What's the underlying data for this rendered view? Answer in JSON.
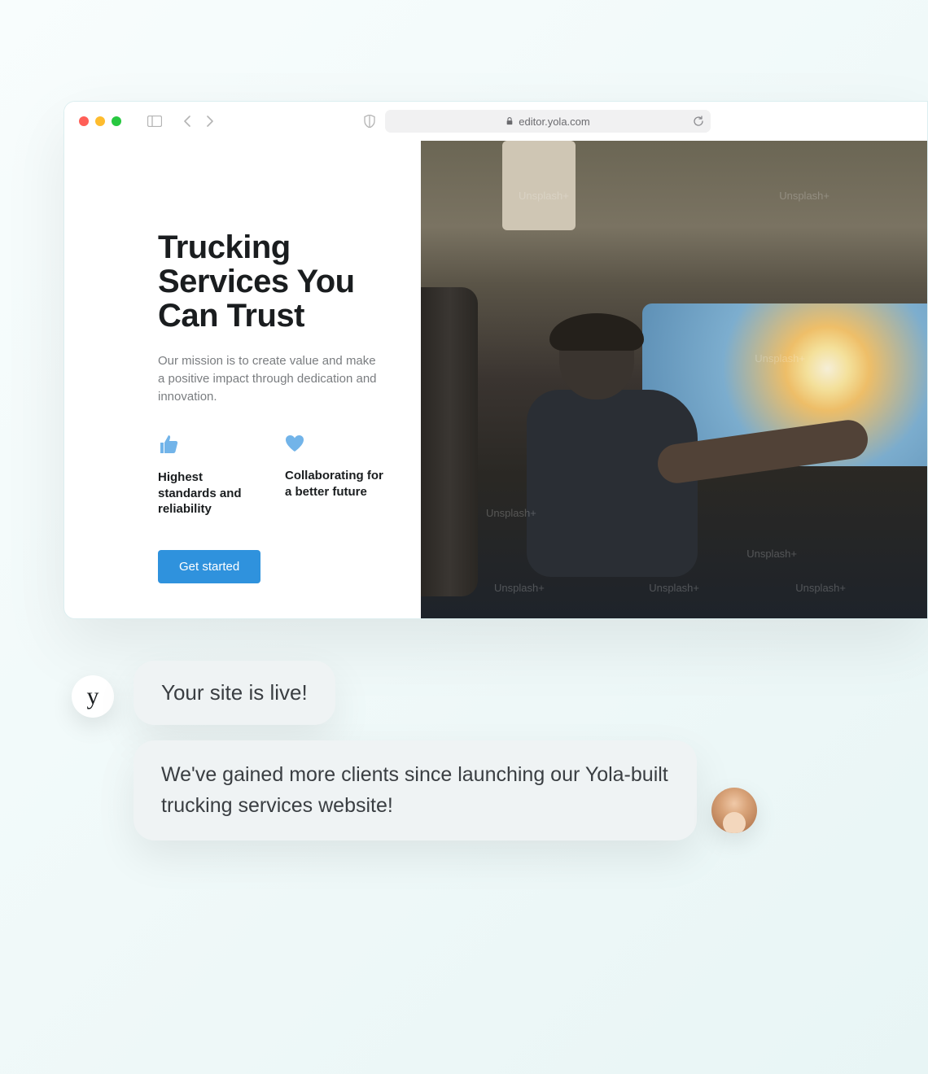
{
  "browser": {
    "url": "editor.yola.com",
    "traffic_light_colors": {
      "red": "#ff5f57",
      "yellow": "#febc2e",
      "green": "#28c840"
    }
  },
  "hero": {
    "title": "Trucking Services You Can Trust",
    "subtitle": "Our mission is to create value and make a positive impact through dedication and innovation.",
    "features": [
      {
        "icon": "thumb-up-icon",
        "label": "Highest standards and reliability"
      },
      {
        "icon": "heart-icon",
        "label": "Collaborating for a better future"
      }
    ],
    "cta_label": "Get started",
    "image_watermark": "Unsplash+"
  },
  "chat": {
    "bot_avatar_letter": "y",
    "messages": [
      {
        "from": "bot",
        "text": "Your site is live!"
      },
      {
        "from": "user",
        "text": "We've gained more clients since launching our Yola-built trucking services website!"
      }
    ]
  },
  "colors": {
    "accent_blue": "#2f92dd",
    "icon_blue": "#72b4e9",
    "bubble_bg": "#eff3f4"
  }
}
